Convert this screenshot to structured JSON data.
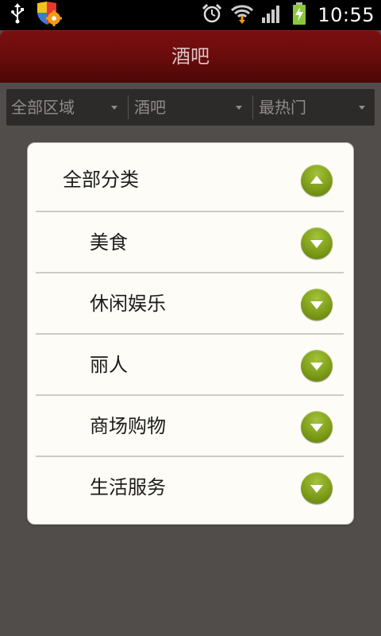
{
  "status_bar": {
    "time": "10:55",
    "icons": [
      "usb-icon",
      "security-shield-icon",
      "alarm-icon",
      "wifi-icon",
      "signal-icon",
      "battery-charging-icon"
    ]
  },
  "title_bar": {
    "title": "酒吧"
  },
  "filters": [
    {
      "label": "全部区域"
    },
    {
      "label": "酒吧"
    },
    {
      "label": "最热门"
    }
  ],
  "dialog": {
    "items": [
      {
        "label": "全部分类",
        "expanded": true
      },
      {
        "label": "美食",
        "expanded": false
      },
      {
        "label": "休闲娱乐",
        "expanded": false
      },
      {
        "label": "丽人",
        "expanded": false
      },
      {
        "label": "商场购物",
        "expanded": false
      },
      {
        "label": "生活服务",
        "expanded": false
      }
    ]
  },
  "colors": {
    "title_bar": "#6a0c0c",
    "title_text": "#d9c2c2",
    "background": "#514d4b",
    "dialog_bg": "#fefcf6",
    "toggle_green": "#7b9a16"
  }
}
